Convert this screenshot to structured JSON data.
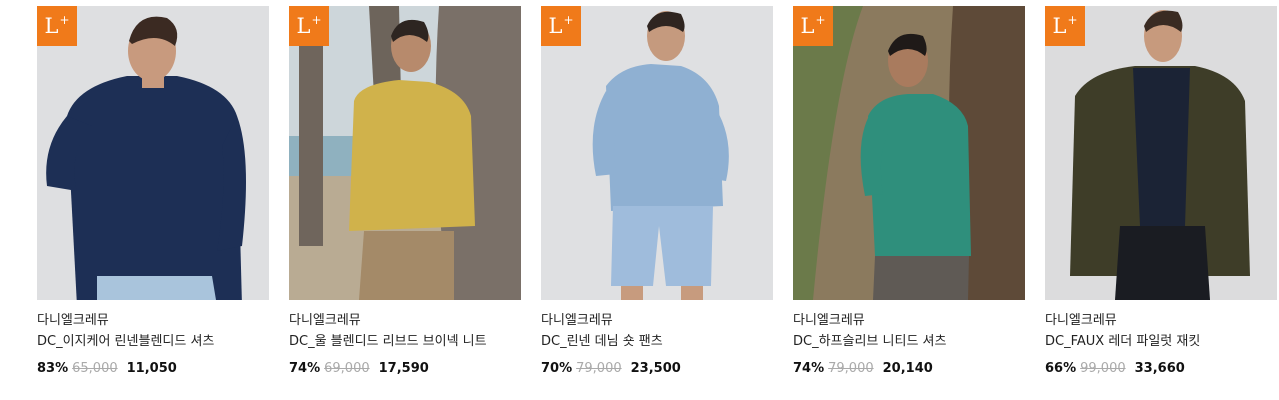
{
  "badge": {
    "label": "L",
    "sup": "+",
    "color": "#f07a1a"
  },
  "products": [
    {
      "brand": "다니엘크레뮤",
      "name": "DC_이지케어 린넨블렌디드 셔츠",
      "discount": "83%",
      "original_price": "65,000",
      "sale_price": "11,050"
    },
    {
      "brand": "다니엘크레뮤",
      "name": "DC_울 블렌디드 리브드 브이넥 니트",
      "discount": "74%",
      "original_price": "69,000",
      "sale_price": "17,590"
    },
    {
      "brand": "다니엘크레뮤",
      "name": "DC_린넨 데님 숏 팬츠",
      "discount": "70%",
      "original_price": "79,000",
      "sale_price": "23,500"
    },
    {
      "brand": "다니엘크레뮤",
      "name": "DC_하프슬리브 니티드 셔츠",
      "discount": "74%",
      "original_price": "79,000",
      "sale_price": "20,140"
    },
    {
      "brand": "다니엘크레뮤",
      "name": "DC_FAUX 레더 파일럿 재킷",
      "discount": "66%",
      "original_price": "99,000",
      "sale_price": "33,660"
    }
  ]
}
